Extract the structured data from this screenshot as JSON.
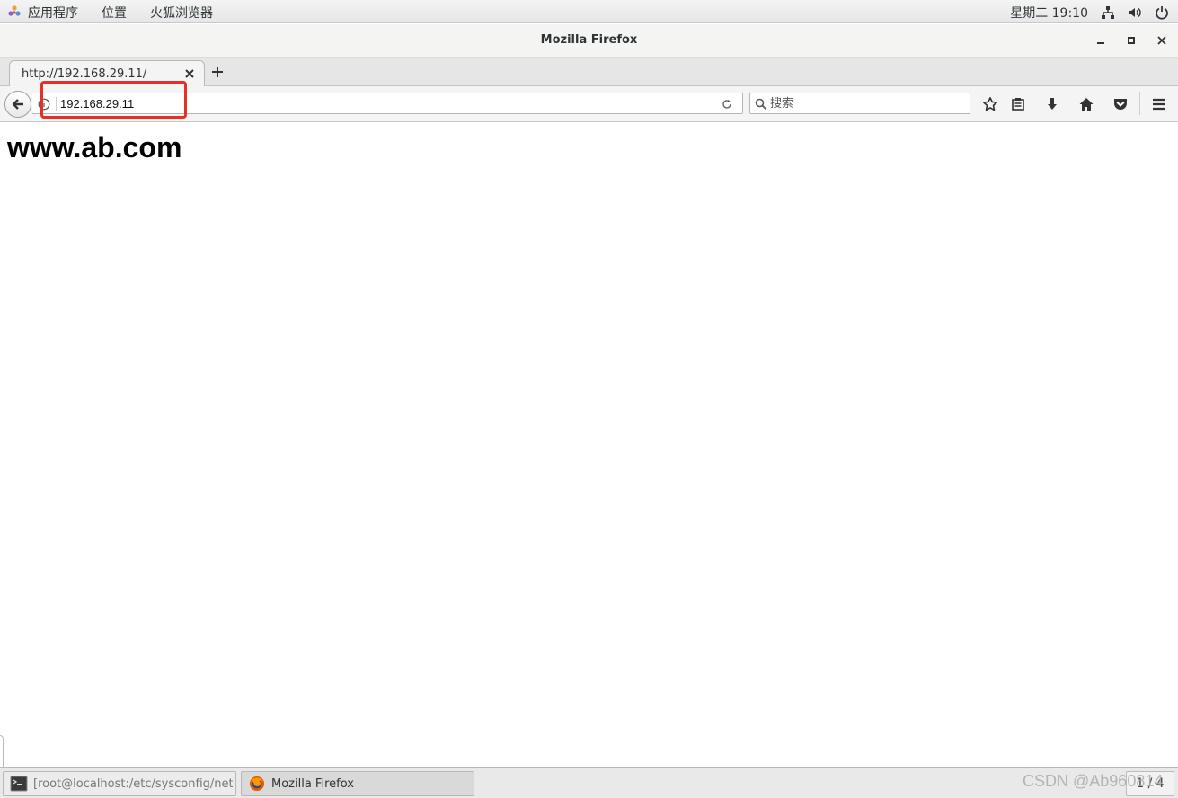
{
  "topbar": {
    "applications_label": "应用程序",
    "places_label": "位置",
    "app_label": "火狐浏览器",
    "clock": "星期二 19:10",
    "icons": [
      "applications-icon",
      "network-icon",
      "volume-icon",
      "power-icon"
    ]
  },
  "window": {
    "title": "Mozilla Firefox",
    "controls": [
      "minimize-icon",
      "maximize-icon",
      "close-icon"
    ]
  },
  "tabs": [
    {
      "title": "http://192.168.29.11/",
      "active": true
    }
  ],
  "navbar": {
    "url": "192.168.29.11",
    "search_placeholder": "搜索",
    "toolbar_icons": [
      "bookmark-star-icon",
      "reading-list-icon",
      "downloads-icon",
      "home-icon",
      "pocket-icon",
      "hamburger-menu-icon"
    ]
  },
  "page": {
    "heading": "www.ab.com"
  },
  "taskbar": {
    "items": [
      {
        "label": "[root@localhost:/etc/sysconfig/net…",
        "icon": "terminal-icon",
        "active": false
      },
      {
        "label": "Mozilla Firefox",
        "icon": "firefox-icon",
        "active": true
      }
    ],
    "workspace": "1 / 4",
    "watermark": "CSDN @Ab960814"
  },
  "colors": {
    "highlight": "#e5302a",
    "topbar_bg": "#eeeeee",
    "page_bg": "#ffffff"
  }
}
